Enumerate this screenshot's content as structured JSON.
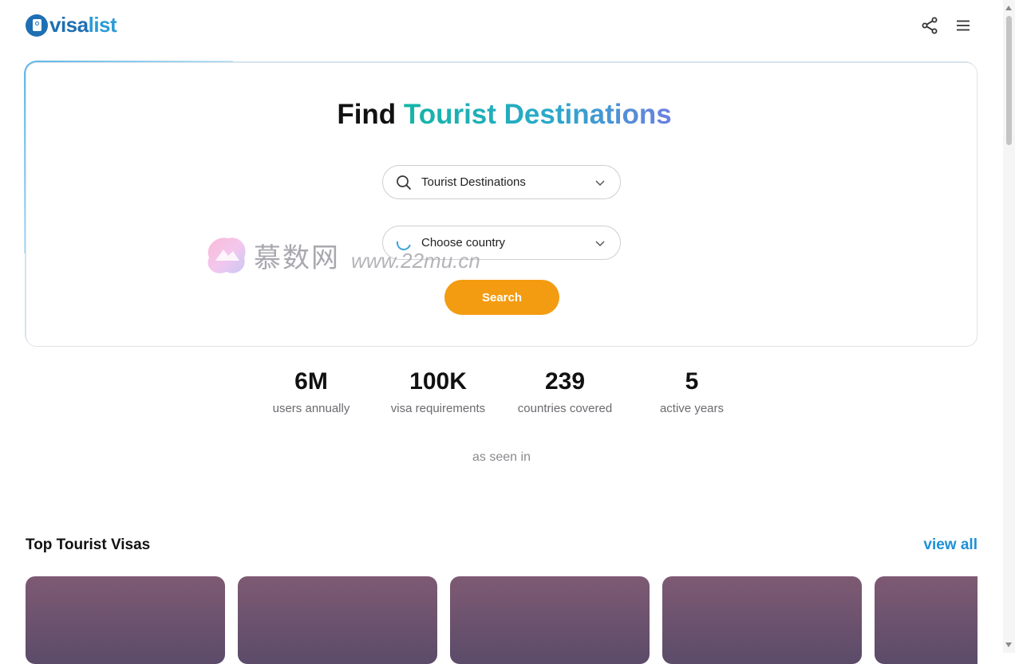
{
  "header": {
    "logo_text_a": "visa",
    "logo_text_b": "list",
    "share_icon": "share-icon",
    "menu_icon": "hamburger-menu-icon"
  },
  "hero": {
    "title_plain": "Find ",
    "title_highlight": "Tourist Destinations",
    "type_select": {
      "value": "Tourist Destinations",
      "icon": "search-icon"
    },
    "country_select": {
      "value": "Choose country",
      "icon": "loading-spinner-icon"
    },
    "search_label": "Search"
  },
  "watermark": {
    "cn": "慕数网",
    "url": "www.22mu.cn"
  },
  "stats": [
    {
      "value": "6M",
      "label": "users annually"
    },
    {
      "value": "100K",
      "label": "visa requirements"
    },
    {
      "value": "239",
      "label": "countries covered"
    },
    {
      "value": "5",
      "label": "active years"
    }
  ],
  "as_seen_in": "as seen in",
  "section": {
    "title": "Top Tourist Visas",
    "view_all": "view all"
  },
  "colors": {
    "brand_blue": "#1f6fb3",
    "accent_orange": "#f39c12",
    "link_blue": "#1e90d6",
    "card_top": "#7e5a73",
    "card_bottom": "#5b4b69"
  }
}
